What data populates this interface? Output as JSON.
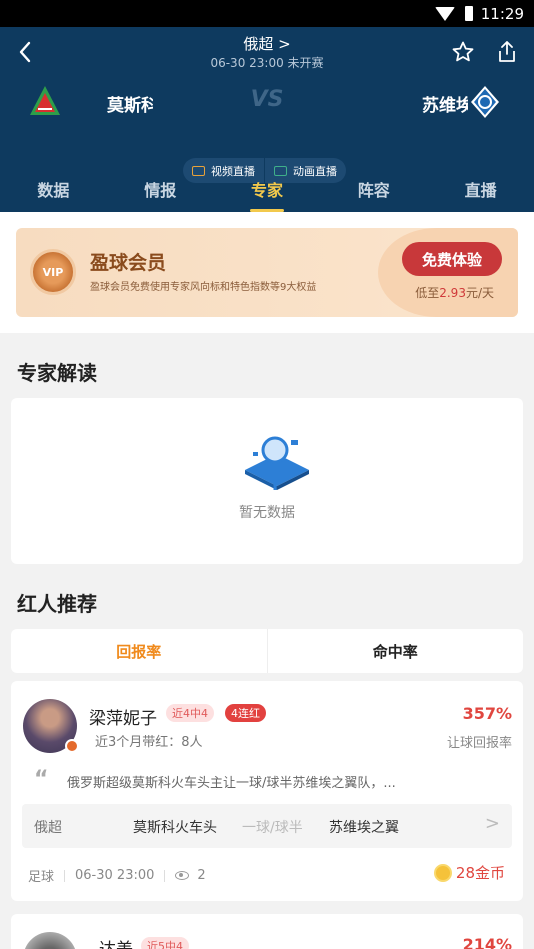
{
  "status_bar": {
    "time": "11:29"
  },
  "header": {
    "league": "俄超 >",
    "match_info": "06-30 23:00 未开赛",
    "home_team": "莫斯科",
    "away_team": "苏维埃",
    "vs": "VS",
    "live_video": "视频直播",
    "live_animation": "动画直播"
  },
  "tabs": [
    {
      "label": "数据"
    },
    {
      "label": "情报"
    },
    {
      "label": "专家"
    },
    {
      "label": "阵容"
    },
    {
      "label": "直播"
    }
  ],
  "active_tab": "专家",
  "vip": {
    "badge": "VIP",
    "title": "盈球会员",
    "desc": "盈球会员免费使用专家风向标和特色指数等9大权益",
    "button": "免费体验",
    "price_prefix": "低至",
    "price_value": "2.93",
    "price_suffix": "元/天"
  },
  "expert_section": {
    "title": "专家解读",
    "empty": "暂无数据"
  },
  "recommend_section": {
    "title": "红人推荐",
    "tab_return": "回报率",
    "tab_hit": "命中率"
  },
  "recommendations": [
    {
      "name": "梁萍妮子",
      "tag_recent": "近4中4",
      "tag_streak": "4连红",
      "sub": "近3个月带红：8人",
      "rate": "357%",
      "rate_label": "让球回报率",
      "quote_mark": "“",
      "quote": "俄罗斯超级莫斯科火车头主让一球/球半苏维埃之翼队，...",
      "match": {
        "league": "俄超",
        "home": "莫斯科火车头",
        "handicap": "一球/球半",
        "away": "苏维埃之翼",
        "chevron": ">"
      },
      "sport": "足球",
      "time": "06-30 23:00",
      "views": "2",
      "price": "28金币"
    },
    {
      "name": "达美",
      "tag_recent": "近5中4",
      "rate": "214%"
    }
  ],
  "colors": {
    "header_bg": "#0e3a5f",
    "accent_yellow": "#f2c94c",
    "accent_orange": "#f08a1c",
    "red": "#e0463f"
  }
}
